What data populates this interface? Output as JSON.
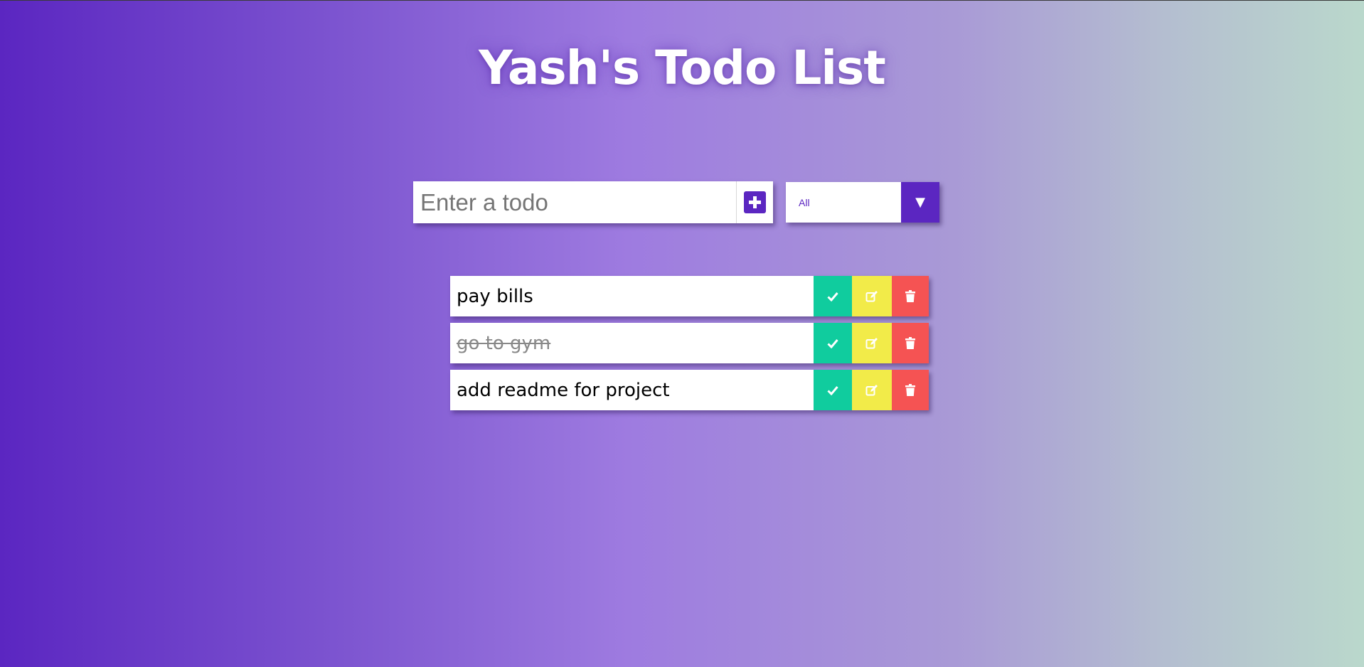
{
  "header": {
    "title": "Yash's Todo List"
  },
  "form": {
    "placeholder": "Enter a todo",
    "add_icon": "plus-square-icon"
  },
  "filter": {
    "selected": "All",
    "arrow": "▼"
  },
  "todos": [
    {
      "text": "pay bills",
      "completed": false
    },
    {
      "text": "go to gym",
      "completed": true
    },
    {
      "text": "add readme for project",
      "completed": false
    }
  ],
  "icons": {
    "complete": "check-icon",
    "edit": "edit-icon",
    "delete": "trash-icon"
  },
  "colors": {
    "accent": "#5b26c1",
    "complete": "#10cc9e",
    "edit": "#f2eb49",
    "delete": "#f55353"
  }
}
